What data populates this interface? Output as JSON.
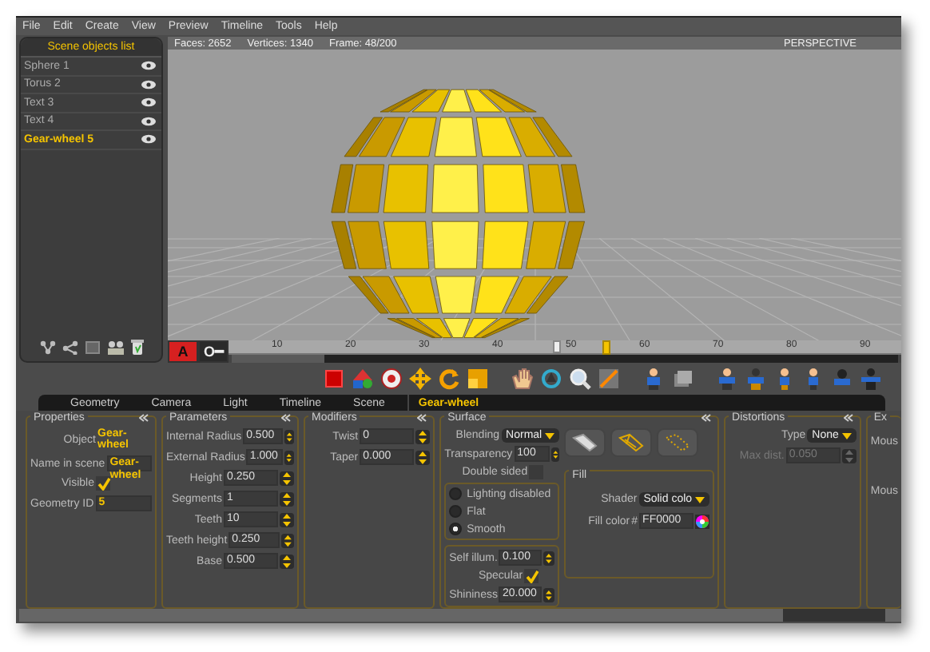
{
  "menu": [
    "File",
    "Edit",
    "Create",
    "View",
    "Preview",
    "Timeline",
    "Tools",
    "Help"
  ],
  "scene_objects": {
    "title": "Scene objects list",
    "items": [
      {
        "label": "Sphere 1",
        "selected": false,
        "visible": true
      },
      {
        "label": "Torus 2",
        "selected": false,
        "visible": true
      },
      {
        "label": "Text 3",
        "selected": false,
        "visible": true
      },
      {
        "label": "Text 4",
        "selected": false,
        "visible": true
      },
      {
        "label": "Gear-wheel 5",
        "selected": true,
        "visible": true
      }
    ]
  },
  "viewport": {
    "stats": [
      "Faces: 2652",
      "Vertices: 1340",
      "Frame: 48/200"
    ],
    "view_name": "PERSPECTIVE"
  },
  "timeline": {
    "buttons": [
      {
        "label": "A",
        "selected": true
      },
      {
        "label": "O━",
        "selected": false
      }
    ],
    "ticks": [
      "10",
      "20",
      "30",
      "40",
      "50",
      "60",
      "70",
      "80",
      "90"
    ],
    "playhead": {
      "level": 0.482
    },
    "keyframe": {
      "level": 0.555
    }
  },
  "tabs": [
    {
      "label": "Geometry",
      "selected": false
    },
    {
      "label": "Camera",
      "selected": false
    },
    {
      "label": "Light",
      "selected": false
    },
    {
      "label": "Timeline",
      "selected": false
    },
    {
      "label": "Scene",
      "selected": false
    },
    {
      "label": "Gear-wheel",
      "selected": true
    }
  ],
  "panels": [
    {
      "title": "Properties",
      "fields": [
        {
          "kind": "value",
          "label": "Object",
          "value": "Gear-wheel"
        },
        {
          "kind": "text",
          "label": "Name in scene",
          "value": "Gear-wheel"
        },
        {
          "kind": "check",
          "label": "Visible",
          "checked": true
        },
        {
          "kind": "text",
          "label": "Geometry ID",
          "value": "5"
        }
      ]
    },
    {
      "title": "Parameters",
      "fields": [
        {
          "kind": "spin",
          "label": "Internal Radius",
          "value": "0.500"
        },
        {
          "kind": "spin",
          "label": "External Radius",
          "value": "1.000"
        },
        {
          "kind": "spin",
          "label": "Height",
          "value": "0.250"
        },
        {
          "kind": "spin",
          "label": "Segments",
          "value": "1"
        },
        {
          "kind": "spin",
          "label": "Teeth",
          "value": "10"
        },
        {
          "kind": "spin",
          "label": "Teeth height",
          "value": "0.250"
        },
        {
          "kind": "spin",
          "label": "Base",
          "value": "0.500"
        }
      ]
    },
    {
      "title": "Modifiers",
      "fields": [
        {
          "kind": "spin",
          "label": "Twist",
          "value": "0"
        },
        {
          "kind": "spin",
          "label": "Taper",
          "value": "0.000"
        }
      ]
    },
    {
      "title": "Surface",
      "fields": [
        {
          "kind": "dropdown",
          "label": "Blending",
          "value": "Normal"
        },
        {
          "kind": "spin",
          "label": "Transparency",
          "value": "100"
        },
        {
          "kind": "check",
          "label": "Double sided",
          "checked": false
        }
      ],
      "shading": [
        {
          "label": "Lighting disabled",
          "selected": false
        },
        {
          "label": "Flat",
          "selected": false
        },
        {
          "label": "Smooth",
          "selected": true
        }
      ],
      "lighting": [
        {
          "kind": "spin",
          "label": "Self illum.",
          "value": "0.100"
        },
        {
          "kind": "check",
          "label": "Specular",
          "checked": true
        },
        {
          "kind": "spin",
          "label": "Shininess",
          "value": "20.000"
        }
      ],
      "fill": {
        "title": "Fill",
        "fields": [
          {
            "kind": "dropdown",
            "label": "Shader",
            "value": "Solid colo"
          },
          {
            "kind": "color",
            "label": "Fill color",
            "prefix": "#",
            "value": "FF0000"
          }
        ]
      }
    },
    {
      "title": "Distortions",
      "fields": [
        {
          "kind": "dropdown",
          "label": "Type",
          "value": "None"
        },
        {
          "kind": "spin",
          "label": "Max dist.",
          "value": "0.050",
          "disabled": true
        }
      ]
    },
    {
      "title": "Ex",
      "fields": [
        {
          "kind": "label",
          "label": "Mous"
        },
        {
          "kind": "label",
          "label": "Mous"
        }
      ]
    }
  ]
}
